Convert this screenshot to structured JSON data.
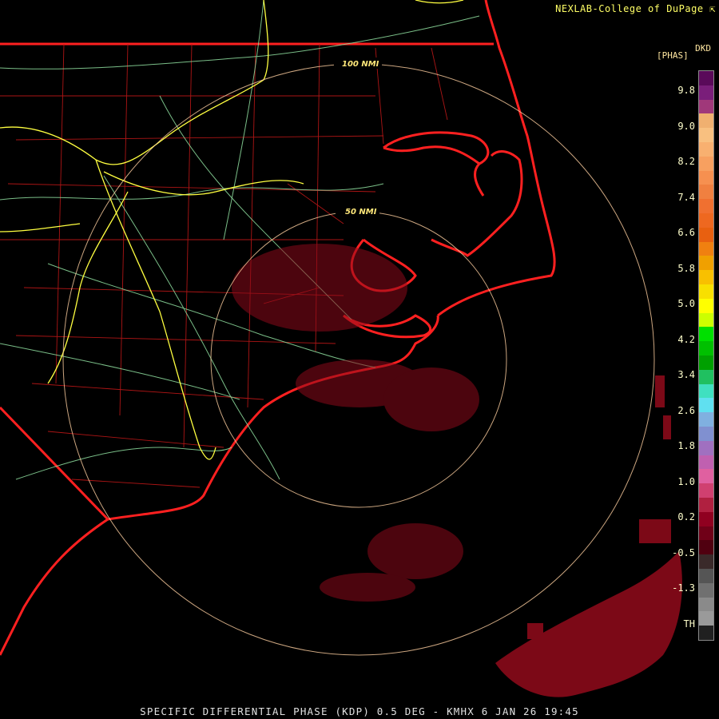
{
  "header": {
    "credit": "NEXLAB-College of DuPage ⇱"
  },
  "colorbar": {
    "product_code": "DKD",
    "units": "[PHAS]",
    "ticks": [
      "9.8",
      "9.0",
      "8.2",
      "7.4",
      "6.6",
      "5.8",
      "5.0",
      "4.2",
      "3.4",
      "2.6",
      "1.8",
      "1.0",
      "0.2",
      "-0.5",
      "-1.3",
      "TH"
    ],
    "colors": [
      "#5a0a5a",
      "#7a1e7a",
      "#a0387a",
      "#f0b070",
      "#f8c080",
      "#f8b070",
      "#f7a060",
      "#f69050",
      "#f08040",
      "#f07030",
      "#ee6820",
      "#e86010",
      "#f08010",
      "#f0a000",
      "#f8c000",
      "#f8e000",
      "#ffff00",
      "#ccff00",
      "#00e000",
      "#00c000",
      "#00a000",
      "#20c060",
      "#40e0c0",
      "#60e0f0",
      "#80b0e0",
      "#8090d0",
      "#a070c0",
      "#c060b0",
      "#e060a0",
      "#d04070",
      "#b02040",
      "#900020",
      "#700018",
      "#500010",
      "#3a2a2a",
      "#555555",
      "#707070",
      "#8a8a8a",
      "#9a9a9a",
      "#202020"
    ]
  },
  "map": {
    "range_rings": [
      {
        "label": "50 NMI"
      },
      {
        "label": "100 NMI"
      }
    ],
    "colors": {
      "state_lines": "#ff2020",
      "county_lines": "#c01818",
      "roads": "#90e0a0",
      "interstates": "#ffff40",
      "rings": "#ffd0a0",
      "echo": "#8a0a1a"
    }
  },
  "footer": {
    "product_line": "SPECIFIC DIFFERENTIAL PHASE (KDP) 0.5 DEG - KMHX 6 JAN 26 19:45"
  }
}
